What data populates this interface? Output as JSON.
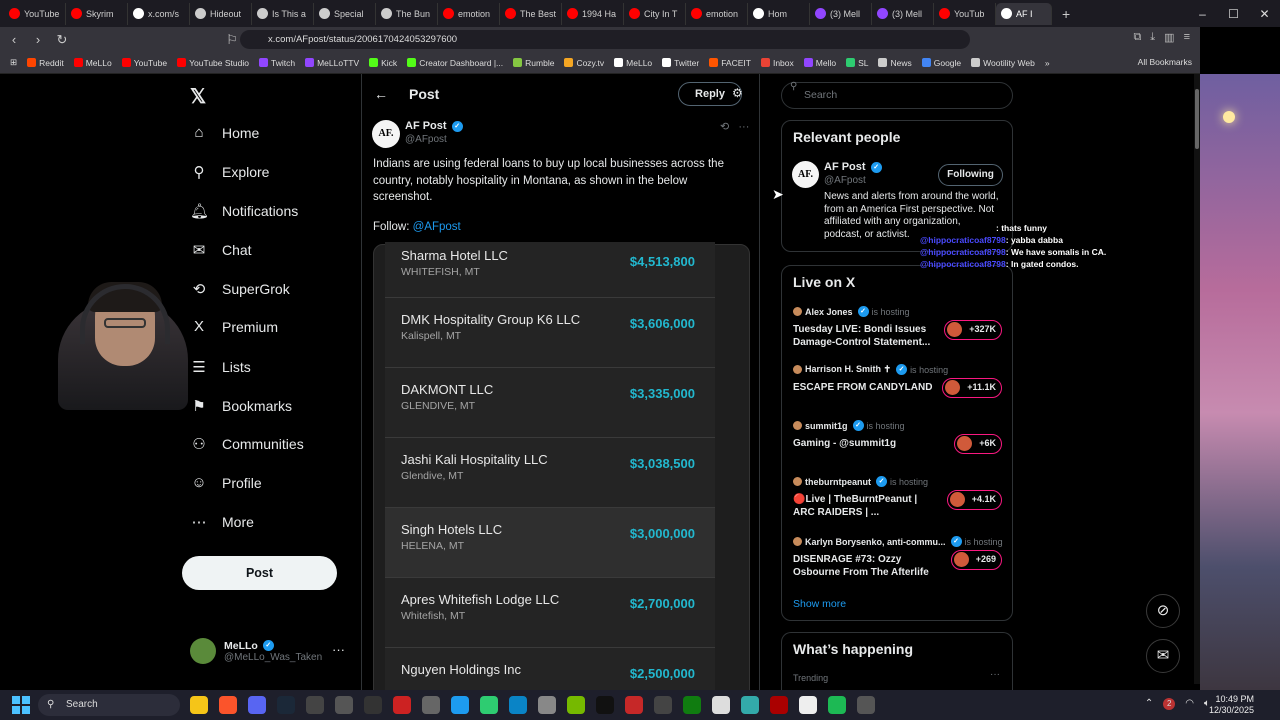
{
  "browser": {
    "tabs": [
      {
        "label": "YouTube",
        "color": "#ff0000"
      },
      {
        "label": "Skyrim",
        "color": "#ff0000"
      },
      {
        "label": "x.com/s",
        "color": "#ffffff"
      },
      {
        "label": "Hideout",
        "color": "#cccccc"
      },
      {
        "label": "Is This a",
        "color": "#cccccc"
      },
      {
        "label": "Special",
        "color": "#cccccc"
      },
      {
        "label": "The Bun",
        "color": "#cccccc"
      },
      {
        "label": "emotion",
        "color": "#ff0000"
      },
      {
        "label": "The Best",
        "color": "#ff0000"
      },
      {
        "label": "1994 Ha",
        "color": "#ff0000"
      },
      {
        "label": "City In T",
        "color": "#ff0000"
      },
      {
        "label": "emotion",
        "color": "#ff0000"
      },
      {
        "label": "Hom",
        "color": "#ffffff"
      },
      {
        "label": "(3) Mell",
        "color": "#9146ff"
      },
      {
        "label": "(3) Mell",
        "color": "#9146ff"
      },
      {
        "label": "YouTub",
        "color": "#ff0000"
      },
      {
        "label": "AF I",
        "color": "#ffffff"
      }
    ],
    "new_tab": "+",
    "window_controls": [
      "–",
      "☐",
      "✕"
    ],
    "url": "x.com/AFpost/status/2006170424053297600",
    "bookmarks": [
      {
        "label": "Reddit",
        "color": "#ff4500"
      },
      {
        "label": "MeLLo",
        "color": "#ff0000"
      },
      {
        "label": "YouTube",
        "color": "#ff0000"
      },
      {
        "label": "YouTube Studio",
        "color": "#ff0000"
      },
      {
        "label": "Twitch",
        "color": "#9146ff"
      },
      {
        "label": "MeLLoTTV",
        "color": "#9146ff"
      },
      {
        "label": "Kick",
        "color": "#53fc18"
      },
      {
        "label": "Creator Dashboard |...",
        "color": "#53fc18"
      },
      {
        "label": "Rumble",
        "color": "#85c742"
      },
      {
        "label": "Cozy.tv",
        "color": "#f5a623"
      },
      {
        "label": "MeLLo",
        "color": "#ffffff"
      },
      {
        "label": "Twitter",
        "color": "#ffffff"
      },
      {
        "label": "FACEIT",
        "color": "#ff5500"
      },
      {
        "label": "Inbox",
        "color": "#ea4335"
      },
      {
        "label": "Mello",
        "color": "#9146ff"
      },
      {
        "label": "SL",
        "color": "#2ecc71"
      },
      {
        "label": "News",
        "color": "#cccccc"
      },
      {
        "label": "Google",
        "color": "#4285f4"
      },
      {
        "label": "Wootility Web",
        "color": "#cccccc"
      }
    ],
    "bookmarks_overflow": "»",
    "all_bookmarks": "All Bookmarks"
  },
  "sidebar": {
    "nav": [
      {
        "label": "Home",
        "icon": "⌂"
      },
      {
        "label": "Explore",
        "icon": "⚲"
      },
      {
        "label": "Notifications",
        "icon": "🔔︎"
      },
      {
        "label": "Chat",
        "icon": "✉"
      },
      {
        "label": "SuperGrok",
        "icon": "⟲"
      },
      {
        "label": "Premium",
        "icon": "X"
      },
      {
        "label": "Lists",
        "icon": "☰"
      },
      {
        "label": "Bookmarks",
        "icon": "⚑"
      },
      {
        "label": "Communities",
        "icon": "⚇"
      },
      {
        "label": "Profile",
        "icon": "☺"
      },
      {
        "label": "More",
        "icon": "⋯"
      }
    ],
    "post_button": "Post",
    "account": {
      "name": "MeLLo",
      "handle": "@MeLLo_Was_Taken",
      "more": "···"
    }
  },
  "post": {
    "header_title": "Post",
    "reply_button": "Reply",
    "author_name": "AF Post",
    "author_handle": "@AFpost",
    "author_avatar": "AF.",
    "text": "Indians are using federal loans to buy up local businesses across the country, notably hospitality in Montana, as shown in the below screenshot.",
    "follow_prefix": "Follow: ",
    "follow_handle": "@AFpost",
    "businesses": [
      {
        "name": "Sharma Hotel LLC",
        "location": "WHITEFISH, MT",
        "amount": "$4,513,800"
      },
      {
        "name": "DMK Hospitality Group K6 LLC",
        "location": "Kalispell, MT",
        "amount": "$3,606,000"
      },
      {
        "name": "DAKMONT LLC",
        "location": "GLENDIVE, MT",
        "amount": "$3,335,000"
      },
      {
        "name": "Jashi Kali Hospitality LLC",
        "location": "Glendive, MT",
        "amount": "$3,038,500"
      },
      {
        "name": "Singh Hotels LLC",
        "location": "HELENA, MT",
        "amount": "$3,000,000"
      },
      {
        "name": "Apres Whitefish Lodge LLC",
        "location": "Whitefish, MT",
        "amount": "$2,700,000"
      },
      {
        "name": "Nguyen Holdings Inc",
        "location": "",
        "amount": "$2,500,000"
      }
    ]
  },
  "right": {
    "search_placeholder": "Search",
    "relevant_title": "Relevant people",
    "relevant": {
      "avatar": "AF.",
      "name": "AF Post",
      "handle": "@AFpost",
      "button": "Following",
      "bio": "News and alerts from around the world, from an America First perspective. Not affiliated with any organization, podcast, or activist."
    },
    "live_title": "Live on X",
    "live": [
      {
        "host": "Alex Jones",
        "hosting": "is hosting",
        "title": "Tuesday LIVE: Bondi Issues Damage-Control Statement...",
        "count": "+327K"
      },
      {
        "host": "Harrison H. Smith ✝",
        "hosting": "is hosting",
        "title": "ESCAPE FROM CANDYLAND",
        "count": "+11.1K"
      },
      {
        "host": "summit1g",
        "hosting": "is hosting",
        "title": "Gaming - @summit1g",
        "count": "+6K"
      },
      {
        "host": "theburntpeanut",
        "hosting": "is hosting",
        "title": "🔴Live | TheBurntPeanut | ARC RAIDERS | ...",
        "count": "+4.1K"
      },
      {
        "host": "Karlyn Borysenko, anti-commu...",
        "hosting": "is hosting",
        "title": "DISENRAGE #73: Ozzy Osbourne From The Afterlife",
        "count": "+269"
      }
    ],
    "show_more": "Show more",
    "happening_title": "What’s happening",
    "trending": "Trending"
  },
  "chat_overlay": [
    {
      "user": "",
      "msg": ": thats funny"
    },
    {
      "user": "@hippocraticoaf8798",
      "msg": ": yabba dabba"
    },
    {
      "user": "@hippocraticoaf8798",
      "msg": ": We have somalis in CA."
    },
    {
      "user": "@hippocraticoaf8798",
      "msg": ": In gated condos."
    }
  ],
  "taskbar": {
    "search": "Search",
    "time": "10:49 PM",
    "date": "12/30/2025",
    "badge": "2"
  }
}
